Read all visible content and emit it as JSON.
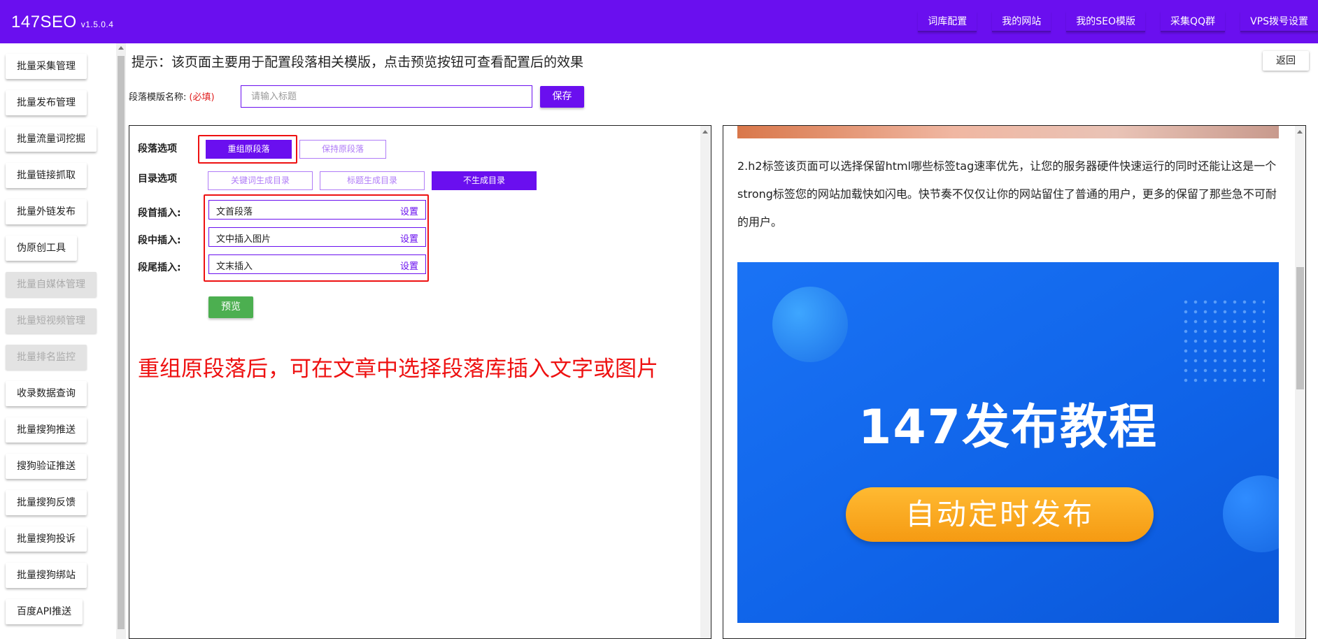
{
  "app": {
    "brand": "147SEO",
    "version": "v1.5.0.4"
  },
  "nav": [
    "词库配置",
    "我的网站",
    "我的SEO模版",
    "采集QQ群",
    "VPS拨号设置"
  ],
  "sidebar": {
    "items": [
      {
        "label": "批量采集管理",
        "disabled": false
      },
      {
        "label": "批量发布管理",
        "disabled": false
      },
      {
        "label": "批量流量词挖掘",
        "disabled": false
      },
      {
        "label": "批量链接抓取",
        "disabled": false
      },
      {
        "label": "批量外链发布",
        "disabled": false
      },
      {
        "label": "伪原创工具",
        "disabled": false
      },
      {
        "label": "批量自媒体管理",
        "disabled": true
      },
      {
        "label": "批量短视频管理",
        "disabled": true
      },
      {
        "label": "批量排名监控",
        "disabled": true
      },
      {
        "label": "收录数据查询",
        "disabled": false
      },
      {
        "label": "批量搜狗推送",
        "disabled": false
      },
      {
        "label": "搜狗验证推送",
        "disabled": false
      },
      {
        "label": "批量搜狗反馈",
        "disabled": false
      },
      {
        "label": "批量搜狗投诉",
        "disabled": false
      },
      {
        "label": "批量搜狗绑站",
        "disabled": false
      },
      {
        "label": "百度API推送",
        "disabled": false
      }
    ]
  },
  "header": {
    "tip": "提示：该页面主要用于配置段落相关模版，点击预览按钮可查看配置后的效果",
    "back_label": "返回",
    "template_label": "段落模版名称:",
    "required_label": "(必填)",
    "template_placeholder": "请输入标题",
    "save_label": "保存"
  },
  "config": {
    "paragraph_label": "段落选项",
    "paragraph_options": [
      "重组原段落",
      "保持原段落"
    ],
    "toc_label": "目录选项",
    "toc_options": [
      "关键词生成目录",
      "标题生成目录",
      "不生成目录"
    ],
    "insert_first_label": "段首插入:",
    "insert_first_value": "文首段落",
    "insert_middle_label": "段中插入:",
    "insert_middle_value": "文中插入图片",
    "insert_last_label": "段尾插入:",
    "insert_last_value": "文末插入",
    "set_label": "设置",
    "preview_label": "预览",
    "annotation": "重组原段落后，可在文章中选择段落库插入文字或图片"
  },
  "preview": {
    "paragraph": "2.h2标签该页面可以选择保留html哪些标签tag速率优先，让您的服务器硬件快速运行的同时还能让这是一个strong标签您的网站加载快如闪电。快节奏不仅仅让你的网站留住了普通的用户，更多的保留了那些急不可耐的用户。",
    "banner_title": "147发布教程",
    "banner_pill": "自动定时发布"
  },
  "colors": {
    "primary": "#6a0fef",
    "accent_red": "#ee1111",
    "preview_green": "#4caf50"
  }
}
